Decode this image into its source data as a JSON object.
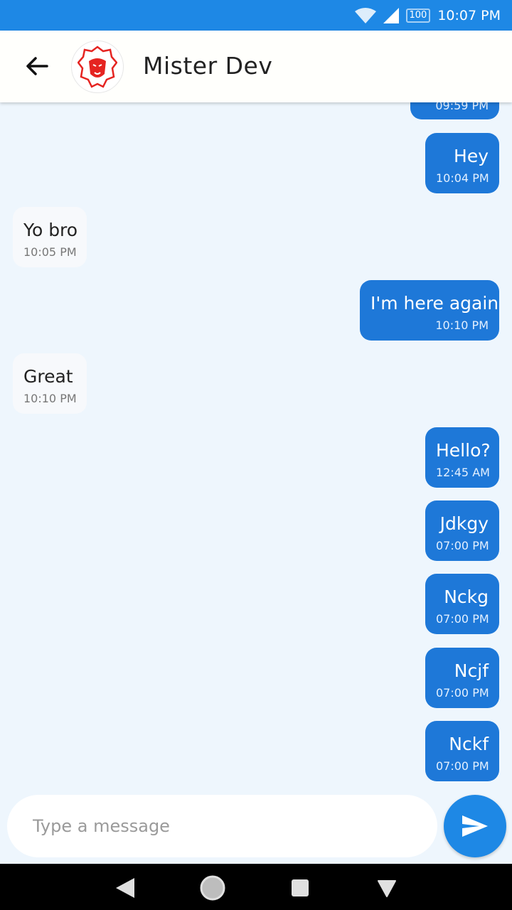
{
  "status_bar": {
    "battery": "100",
    "time": "10:07 PM",
    "background_color": "#1e88e5"
  },
  "header": {
    "contact_name": "Mister Dev",
    "back_icon": "arrow-left-icon",
    "avatar_icon": "lion-logo-icon"
  },
  "messages": [
    {
      "direction": "sent",
      "text": "",
      "time": "09:59 PM",
      "partial": true
    },
    {
      "direction": "sent",
      "text": "Hey",
      "time": "10:04 PM"
    },
    {
      "direction": "received",
      "text": "Yo bro",
      "time": "10:05 PM"
    },
    {
      "direction": "sent",
      "text": "I'm here again",
      "time": "10:10 PM"
    },
    {
      "direction": "received",
      "text": "Great",
      "time": "10:10 PM"
    },
    {
      "direction": "sent",
      "text": "Hello?",
      "time": "12:45 AM"
    },
    {
      "direction": "sent",
      "text": "Jdkgy",
      "time": "07:00 PM"
    },
    {
      "direction": "sent",
      "text": "Nckg",
      "time": "07:00 PM"
    },
    {
      "direction": "sent",
      "text": "Ncjf",
      "time": "07:00 PM"
    },
    {
      "direction": "sent",
      "text": "Nckf",
      "time": "07:00 PM"
    }
  ],
  "composer": {
    "placeholder": "Type a message",
    "value": "",
    "send_icon": "send-icon"
  },
  "colors": {
    "accent": "#1e88e5",
    "sent_bubble": "#1e78d8",
    "received_bubble": "#f7f9fc",
    "chat_background": "#eef6fd"
  }
}
